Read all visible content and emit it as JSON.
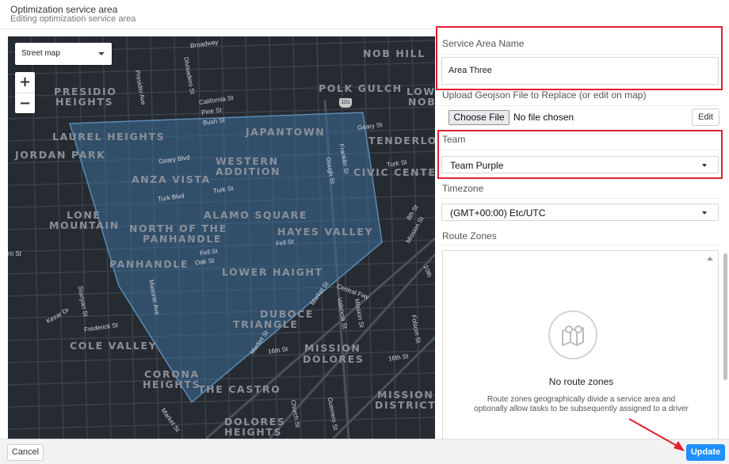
{
  "header": {
    "title": "Optimization service area",
    "subtitle": "Editing optimization service area"
  },
  "map": {
    "type_select": "Street map",
    "zoom_in": "+",
    "zoom_out": "−",
    "neighborhoods": [
      "NOB HILL",
      "PRESIDIO",
      "HEIGHTS",
      "POLK GULCH",
      "LOW",
      "NOB",
      "LAUREL HEIGHTS",
      "JAPANTOWN",
      "TENDERLOI",
      "JORDAN PARK",
      "WESTERN",
      "ADDITION",
      "ANZA VISTA",
      "CIVIC CENTE",
      "LONE",
      "MOUNTAIN",
      "ALAMO SQUARE",
      "NORTH OF THE",
      "PANHANDLE",
      "HAYES VALLEY",
      "PANHANDLE",
      "LOWER HAIGHT",
      "DUBOCE",
      "TRIANGLE",
      "COLE VALLEY",
      "MISSION",
      "DOLORES",
      "CORONA",
      "HEIGHTS",
      "THE CASTRO",
      "MISSION",
      "DISTRICT",
      "DOLORES",
      "HEIGHTS"
    ],
    "streets": [
      "Broadway",
      "Presidio Ave",
      "Divisadero St",
      "California St",
      "Pine St",
      "Bush St",
      "Geary St",
      "Geary Blvd",
      "Turk St",
      "Turk Blvd",
      "Franklin St",
      "Gough St",
      "Turk St",
      "8th St",
      "Mission St",
      "10th",
      "Fell St",
      "Fell St",
      "Oak St",
      "Central Fwy",
      "Masonic Ave",
      "Stanyan St",
      "Kezar Dr",
      "Frederick St",
      "Market St",
      "Valencia St",
      "Mission St",
      "Folsom St",
      "Market St",
      "16th St",
      "16th St",
      "Church St",
      "Guerrero St",
      "Market St",
      "ro St"
    ],
    "highway_shields": [
      "101"
    ]
  },
  "form": {
    "service_area_name": {
      "label": "Service Area Name",
      "value": "Area Three"
    },
    "upload": {
      "label": "Upload Geojson File to Replace (or edit on map)",
      "choose_file": "Choose File",
      "status": "No file chosen",
      "edit": "Edit"
    },
    "team": {
      "label": "Team",
      "value": "Team Purple"
    },
    "timezone": {
      "label": "Timezone",
      "value": "(GMT+00:00) Etc/UTC"
    },
    "route_zones": {
      "label": "Route Zones",
      "empty_title": "No route zones",
      "empty_desc_1": "Route zones geographically divide a service area and",
      "empty_desc_2": "optionally allow tasks to be subsequently assigned to a driver"
    }
  },
  "footer": {
    "cancel": "Cancel",
    "update": "Update"
  },
  "colors": {
    "highlight": "#e0202e",
    "primary": "#1e90ff",
    "map_bg": "#262b31",
    "polygon_fill": "#3c6e99"
  }
}
